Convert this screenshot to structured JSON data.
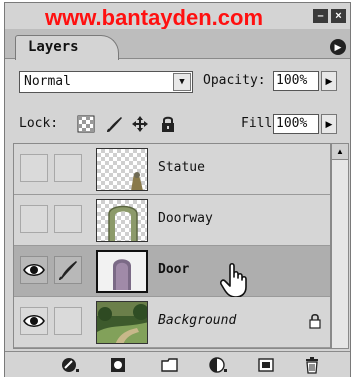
{
  "watermark": "www.bantayden.com",
  "panel": {
    "tab_label": "Layers"
  },
  "blend": {
    "mode": "Normal",
    "opacity_label": "Opacity:",
    "opacity_value": "100%"
  },
  "lock": {
    "label": "Lock:",
    "fill_label": "Fill:",
    "fill_value": "100%"
  },
  "layers": [
    {
      "name": "Statue",
      "visible": false,
      "selected": false,
      "locked": false
    },
    {
      "name": "Doorway",
      "visible": false,
      "selected": false,
      "locked": false
    },
    {
      "name": "Door",
      "visible": true,
      "selected": true,
      "locked": false
    },
    {
      "name": "Background",
      "visible": true,
      "selected": false,
      "locked": true
    }
  ],
  "colors": {
    "watermark": "#ff1010",
    "panel_bg": "#d4d4d4",
    "selected_row": "#aeaeae"
  }
}
